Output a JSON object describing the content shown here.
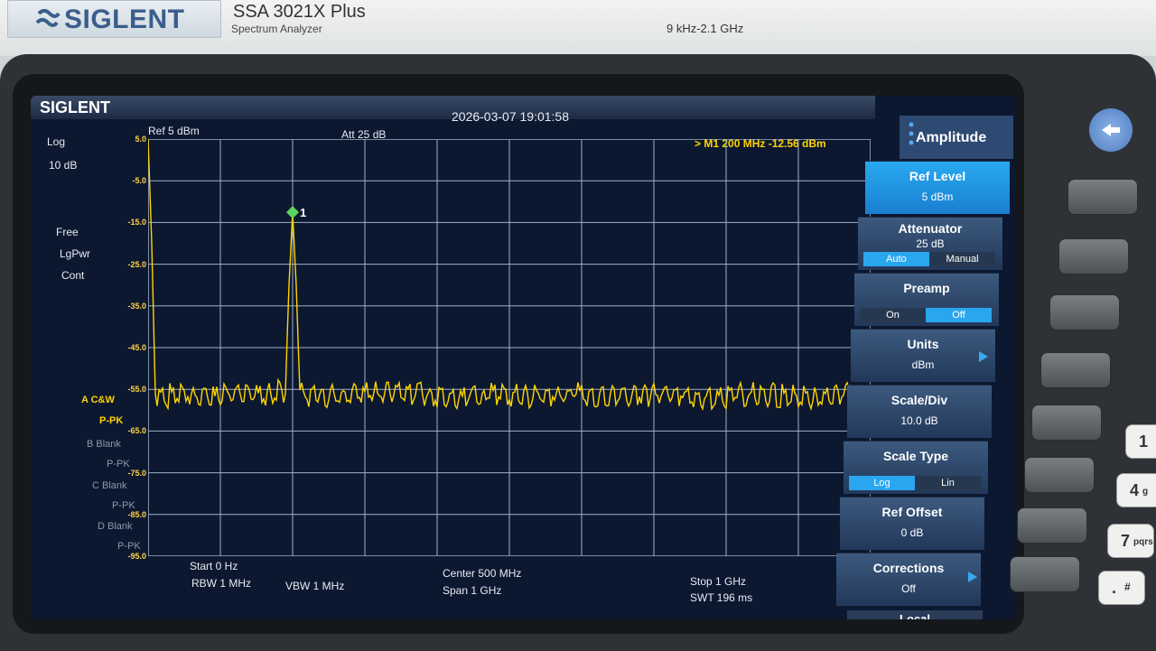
{
  "instrument": {
    "brand": "SIGLENT",
    "model": "SSA 3021X Plus",
    "subtitle": "Spectrum Analyzer",
    "freq_range": "9 kHz-2.1 GHz"
  },
  "screen": {
    "logo": "SIGLENT",
    "datetime": "2026-03-07 19:01:58",
    "ref_level": "Ref  5 dBm",
    "att": "Att  25 dB",
    "marker_readout": "> M1   200 MHz   -12.56 dBm",
    "scale_mode": "Log",
    "scale_div": "10 dB",
    "trigger": "Free",
    "detector": "LgPwr",
    "sweep_mode": "Cont",
    "y_ticks": [
      "5.0",
      "-5.0",
      "-15.0",
      "-25.0",
      "-35.0",
      "-45.0",
      "-55.0",
      "-65.0",
      "-75.0",
      "-85.0",
      "-95.0"
    ],
    "traces": [
      {
        "label": "A  C&W",
        "mode": "P-PK",
        "color": "#ffd400"
      },
      {
        "label": "B  Blank",
        "mode": "P-PK",
        "color": "#8c99aa"
      },
      {
        "label": "C  Blank",
        "mode": "P-PK",
        "color": "#8c99aa"
      },
      {
        "label": "D  Blank",
        "mode": "P-PK",
        "color": "#8c99aa"
      }
    ],
    "marker_label": "1",
    "footer": {
      "start": "Start  0 Hz",
      "rbw": "RBW  1 MHz",
      "vbw": "VBW  1 MHz",
      "center": "Center  500 MHz",
      "span": "Span    1 GHz",
      "stop": "Stop  1 GHz",
      "swt": "SWT  196 ms"
    }
  },
  "menu": {
    "title": "Amplitude",
    "items": [
      {
        "label": "Ref Level",
        "value": "5 dBm"
      },
      {
        "label": "Attenuator",
        "value": "25 dB",
        "options": [
          "Auto",
          "Manual"
        ]
      },
      {
        "label": "Preamp",
        "options": [
          "On",
          "Off"
        ]
      },
      {
        "label": "Units",
        "value": "dBm"
      },
      {
        "label": "Scale/Div",
        "value": "10.0 dB"
      },
      {
        "label": "Scale Type",
        "options": [
          "Log",
          "Lin"
        ]
      },
      {
        "label": "Ref Offset",
        "value": "0 dB"
      },
      {
        "label": "Corrections",
        "value": "Off"
      }
    ],
    "local_label": "Local"
  },
  "keypad": {
    "keys": [
      "1",
      "4",
      "7",
      "."
    ],
    "key_subs": [
      "",
      "g",
      "pqrs",
      "#"
    ]
  },
  "chart_data": {
    "type": "line",
    "xlim": [
      0,
      1000
    ],
    "ylim": [
      -95,
      5
    ],
    "xlabel": "",
    "ylabel": "",
    "grid": true,
    "series": [
      {
        "name": "A",
        "x_unit": "MHz",
        "y_unit": "dBm",
        "x": [
          0,
          5,
          10,
          20,
          40,
          80,
          120,
          160,
          190,
          195,
          200,
          205,
          210,
          240,
          300,
          360,
          420,
          480,
          540,
          600,
          660,
          720,
          780,
          840,
          900,
          960,
          1000
        ],
        "y": [
          5,
          -20,
          -56,
          -57,
          -56,
          -57,
          -56,
          -57,
          -55,
          -30,
          -12.56,
          -30,
          -56,
          -57,
          -56,
          -56,
          -57,
          -56,
          -57,
          -56,
          -57,
          -56,
          -57,
          -56,
          -57,
          -56,
          -57
        ]
      }
    ],
    "markers": [
      {
        "name": "M1",
        "x": 200,
        "y": -12.56
      }
    ]
  }
}
